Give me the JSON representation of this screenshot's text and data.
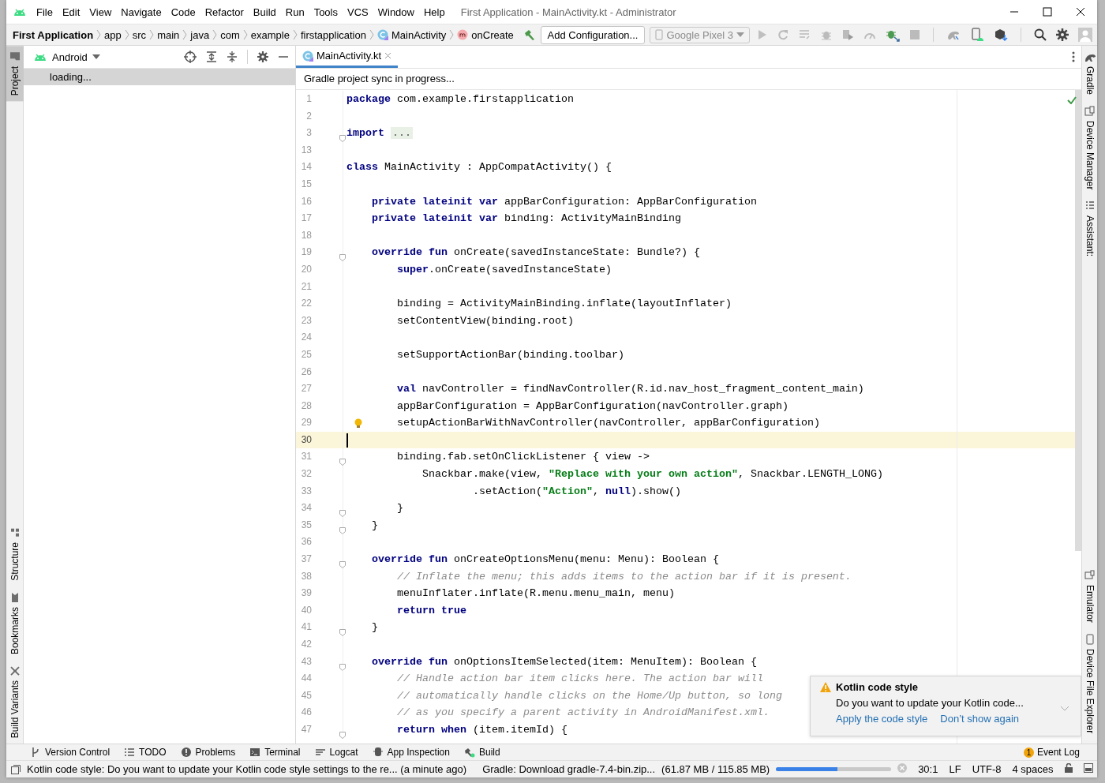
{
  "window": {
    "title": "First Application - MainActivity.kt - Administrator"
  },
  "menu": [
    "File",
    "Edit",
    "View",
    "Navigate",
    "Code",
    "Refactor",
    "Build",
    "Run",
    "Tools",
    "VCS",
    "Window",
    "Help"
  ],
  "breadcrumbs": [
    {
      "label": "First Application",
      "kind": "project"
    },
    {
      "label": "app",
      "kind": "folder"
    },
    {
      "label": "src",
      "kind": "folder"
    },
    {
      "label": "main",
      "kind": "folder"
    },
    {
      "label": "java",
      "kind": "folder"
    },
    {
      "label": "com",
      "kind": "folder"
    },
    {
      "label": "example",
      "kind": "folder"
    },
    {
      "label": "firstapplication",
      "kind": "folder"
    },
    {
      "label": "MainActivity",
      "kind": "class"
    },
    {
      "label": "onCreate",
      "kind": "method"
    }
  ],
  "toolbar": {
    "run_configuration": "Add Configuration...",
    "device": "Google Pixel 3"
  },
  "left_tool_windows": {
    "top": [
      {
        "label": "Project",
        "selected": true
      }
    ],
    "bottom": [
      {
        "label": "Structure",
        "selected": false
      },
      {
        "label": "Bookmarks",
        "selected": false
      },
      {
        "label": "Build Variants",
        "selected": false
      }
    ]
  },
  "project_panel": {
    "view": "Android",
    "rows": [
      {
        "label": "loading...",
        "selected": true
      }
    ]
  },
  "editor": {
    "tabs": [
      {
        "label": "MainActivity.kt",
        "selected": true
      }
    ],
    "banner": "Gradle project sync in progress...",
    "lines": [
      {
        "number": "1",
        "fold": false,
        "current": false,
        "bulb": false,
        "tokens": [
          {
            "kind": "keyword",
            "text": "package"
          },
          {
            "kind": "plain",
            "text": " com.example.firstapplication"
          }
        ]
      },
      {
        "number": "2",
        "fold": false,
        "current": false,
        "bulb": false
      },
      {
        "number": "3",
        "fold": true,
        "current": false,
        "bulb": false,
        "tokens": [
          {
            "kind": "keyword",
            "text": "import"
          },
          {
            "kind": "folded",
            "text": "..."
          }
        ]
      },
      {
        "number": "13",
        "fold": false,
        "current": false,
        "bulb": false
      },
      {
        "number": "14",
        "fold": false,
        "current": false,
        "bulb": false,
        "tokens": [
          {
            "kind": "keyword",
            "text": "class"
          },
          {
            "kind": "plain",
            "text": " MainActivity : AppCompatActivity() {"
          }
        ]
      },
      {
        "number": "15",
        "fold": false,
        "current": false,
        "bulb": false
      },
      {
        "number": "16",
        "fold": false,
        "current": false,
        "bulb": false,
        "tokens": [
          {
            "kind": "keyword",
            "text": "    private lateinit var"
          },
          {
            "kind": "plain",
            "text": " appBarConfiguration: AppBarConfiguration"
          }
        ]
      },
      {
        "number": "17",
        "fold": false,
        "current": false,
        "bulb": false,
        "tokens": [
          {
            "kind": "keyword",
            "text": "    private lateinit var"
          },
          {
            "kind": "plain",
            "text": " binding: ActivityMainBinding"
          }
        ]
      },
      {
        "number": "18",
        "fold": false,
        "current": false,
        "bulb": false
      },
      {
        "number": "19",
        "fold": true,
        "current": false,
        "bulb": false,
        "tokens": [
          {
            "kind": "keyword",
            "text": "    override fun"
          },
          {
            "kind": "plain",
            "text": " onCreate(savedInstanceState: Bundle?) {"
          }
        ]
      },
      {
        "number": "20",
        "fold": false,
        "current": false,
        "bulb": false,
        "tokens": [
          {
            "kind": "keyword",
            "text": "        super"
          },
          {
            "kind": "plain",
            "text": ".onCreate(savedInstanceState)"
          }
        ]
      },
      {
        "number": "21",
        "fold": false,
        "current": false,
        "bulb": false
      },
      {
        "number": "22",
        "fold": false,
        "current": false,
        "bulb": false,
        "tokens": [
          {
            "kind": "plain",
            "text": "        binding = ActivityMainBinding.inflate(layoutInflater)"
          }
        ]
      },
      {
        "number": "23",
        "fold": false,
        "current": false,
        "bulb": false,
        "tokens": [
          {
            "kind": "plain",
            "text": "        setContentView(binding.root)"
          }
        ]
      },
      {
        "number": "24",
        "fold": false,
        "current": false,
        "bulb": false
      },
      {
        "number": "25",
        "fold": false,
        "current": false,
        "bulb": false,
        "tokens": [
          {
            "kind": "plain",
            "text": "        setSupportActionBar(binding.toolbar)"
          }
        ]
      },
      {
        "number": "26",
        "fold": false,
        "current": false,
        "bulb": false
      },
      {
        "number": "27",
        "fold": false,
        "current": false,
        "bulb": false,
        "tokens": [
          {
            "kind": "keyword",
            "text": "        val"
          },
          {
            "kind": "plain",
            "text": " navController = findNavController(R.id.nav_host_fragment_content_main)"
          }
        ]
      },
      {
        "number": "28",
        "fold": false,
        "current": false,
        "bulb": false,
        "tokens": [
          {
            "kind": "plain",
            "text": "        appBarConfiguration = AppBarConfiguration(navController.graph)"
          }
        ]
      },
      {
        "number": "29",
        "fold": false,
        "current": false,
        "bulb": true,
        "tokens": [
          {
            "kind": "plain",
            "text": "        setupActionBarWithNavController(navController, appBarConfiguration)"
          }
        ]
      },
      {
        "number": "30",
        "fold": false,
        "current": true,
        "bulb": false
      },
      {
        "number": "31",
        "fold": true,
        "current": false,
        "bulb": false,
        "tokens": [
          {
            "kind": "plain",
            "text": "        binding.fab.setOnClickListener { view ->"
          }
        ]
      },
      {
        "number": "32",
        "fold": false,
        "current": false,
        "bulb": false,
        "tokens": [
          {
            "kind": "plain",
            "text": "            Snackbar.make(view, "
          },
          {
            "kind": "string",
            "text": "\"Replace with your own action\""
          },
          {
            "kind": "plain",
            "text": ", Snackbar.LENGTH_LONG)"
          }
        ]
      },
      {
        "number": "33",
        "fold": false,
        "current": false,
        "bulb": false,
        "tokens": [
          {
            "kind": "plain",
            "text": "                    .setAction("
          },
          {
            "kind": "string",
            "text": "\"Action\""
          },
          {
            "kind": "plain",
            "text": ", "
          },
          {
            "kind": "keyword",
            "text": "null"
          },
          {
            "kind": "plain",
            "text": ").show()"
          }
        ]
      },
      {
        "number": "34",
        "fold": true,
        "current": false,
        "bulb": false,
        "tokens": [
          {
            "kind": "plain",
            "text": "        }"
          }
        ]
      },
      {
        "number": "35",
        "fold": true,
        "current": false,
        "bulb": false,
        "tokens": [
          {
            "kind": "plain",
            "text": "    }"
          }
        ]
      },
      {
        "number": "36",
        "fold": false,
        "current": false,
        "bulb": false
      },
      {
        "number": "37",
        "fold": true,
        "current": false,
        "bulb": false,
        "tokens": [
          {
            "kind": "keyword",
            "text": "    override fun"
          },
          {
            "kind": "plain",
            "text": " onCreateOptionsMenu(menu: Menu): Boolean {"
          }
        ]
      },
      {
        "number": "38",
        "fold": false,
        "current": false,
        "bulb": false,
        "tokens": [
          {
            "kind": "comment",
            "text": "        // Inflate the menu; this adds items to the action bar if it is present."
          }
        ]
      },
      {
        "number": "39",
        "fold": false,
        "current": false,
        "bulb": false,
        "tokens": [
          {
            "kind": "plain",
            "text": "        menuInflater.inflate(R.menu.menu_main, menu)"
          }
        ]
      },
      {
        "number": "40",
        "fold": false,
        "current": false,
        "bulb": false,
        "tokens": [
          {
            "kind": "keyword",
            "text": "        return true"
          }
        ]
      },
      {
        "number": "41",
        "fold": true,
        "current": false,
        "bulb": false,
        "tokens": [
          {
            "kind": "plain",
            "text": "    }"
          }
        ]
      },
      {
        "number": "42",
        "fold": false,
        "current": false,
        "bulb": false
      },
      {
        "number": "43",
        "fold": true,
        "current": false,
        "bulb": false,
        "tokens": [
          {
            "kind": "keyword",
            "text": "    override fun"
          },
          {
            "kind": "plain",
            "text": " onOptionsItemSelected(item: MenuItem): Boolean {"
          }
        ]
      },
      {
        "number": "44",
        "fold": false,
        "current": false,
        "bulb": false,
        "tokens": [
          {
            "kind": "comment",
            "text": "        // Handle action bar item clicks here. The action bar will"
          }
        ]
      },
      {
        "number": "45",
        "fold": false,
        "current": false,
        "bulb": false,
        "tokens": [
          {
            "kind": "comment",
            "text": "        // automatically handle clicks on the Home/Up button, so long"
          }
        ]
      },
      {
        "number": "46",
        "fold": false,
        "current": false,
        "bulb": false,
        "tokens": [
          {
            "kind": "comment",
            "text": "        // as you specify a parent activity in AndroidManifest.xml."
          }
        ]
      },
      {
        "number": "47",
        "fold": true,
        "current": false,
        "bulb": false,
        "tokens": [
          {
            "kind": "keyword",
            "text": "        return when"
          },
          {
            "kind": "plain",
            "text": " (item.itemId) {"
          }
        ]
      }
    ]
  },
  "right_tool_windows": {
    "top": [
      {
        "label": "Gradle"
      },
      {
        "label": "Device Manager"
      },
      {
        "label": "Assistant:"
      }
    ],
    "bottom": [
      {
        "label": "Emulator"
      },
      {
        "label": "Device File Explorer"
      }
    ]
  },
  "notification": {
    "title": "Kotlin code style",
    "message": "Do you want to update your Kotlin code...",
    "actions": [
      "Apply the code style",
      "Don’t show again"
    ]
  },
  "bottom_tool_windows": [
    "Version Control",
    "TODO",
    "Problems",
    "Terminal",
    "Logcat",
    "App Inspection",
    "Build"
  ],
  "event_log": {
    "count": "1",
    "label": "Event Log"
  },
  "status_bar": {
    "message": "Kotlin code style: Do you want to update your Kotlin code style settings to the re... (a minute ago)",
    "progress_label": "Gradle: Download gradle-7.4-bin.zip...",
    "progress_size": "(61.87 MB / 115.85 MB)",
    "level": 0.53,
    "position": "30:1",
    "line_separator": "LF",
    "encoding": "UTF-8",
    "indent": "4 spaces"
  }
}
